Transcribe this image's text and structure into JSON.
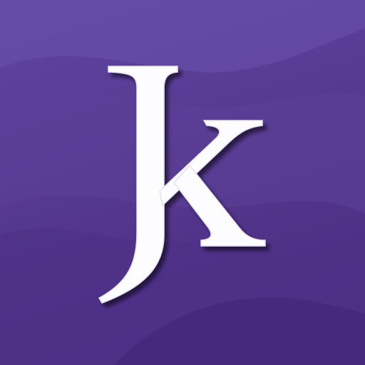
{
  "logo": {
    "text": "Jk",
    "icon": "jk-monogram-logo-icon",
    "colors": {
      "background_top": "#5f45a0",
      "background_mid": "#55388f",
      "background_bottom": "#4a2c82",
      "wave_light": "#6a52ad",
      "wave_dark": "#46297b",
      "letter_fill": "#fdfcff",
      "letter_shadow": "#2f1a57"
    }
  }
}
